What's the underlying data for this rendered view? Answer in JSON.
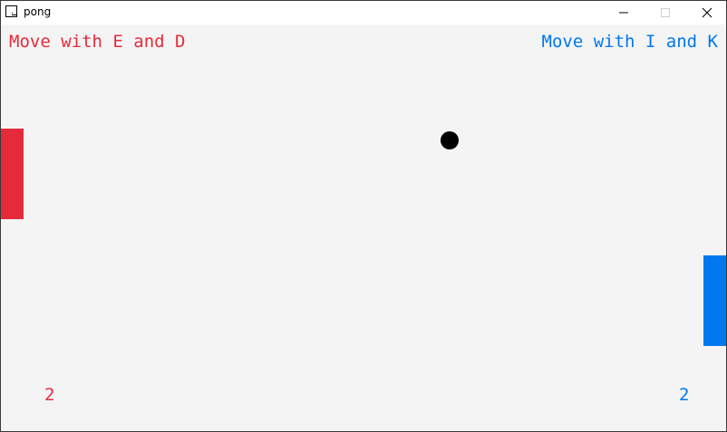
{
  "window": {
    "title": "pong",
    "icon": "app-window-icon",
    "controls": {
      "minimize_icon": "minimize-icon",
      "maximize_icon": "maximize-icon",
      "close_icon": "close-icon"
    }
  },
  "game": {
    "background_color": "#f4f4f4",
    "left_player": {
      "hint": "Move with E and D",
      "score": "2",
      "color": "#e52b3a"
    },
    "right_player": {
      "hint": "Move with I and K",
      "score": "2",
      "color": "#0078ee"
    },
    "ball_color": "#000000"
  }
}
